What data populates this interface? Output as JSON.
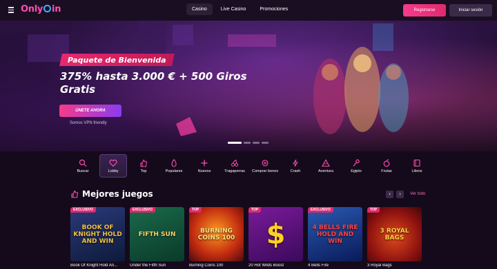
{
  "brand": {
    "logo_left": "Only",
    "logo_right": "in",
    "accent": "#ff4fb0"
  },
  "header": {
    "nav": [
      "Casino",
      "Live Casino",
      "Promociones"
    ],
    "register_label": "Registrarse",
    "login_label": "Iniciar sesión"
  },
  "hero": {
    "tag": "Paquete de Bienvenida",
    "title": "375% hasta 3.000 € + 500 Giros Gratis",
    "cta_label": "ÚNETE AHORA",
    "note": "Somos VPN friendly",
    "slides": 4,
    "active_slide": 1
  },
  "categories": [
    {
      "label": "Buscar",
      "icon": "search-icon"
    },
    {
      "label": "Lobby",
      "icon": "heart-icon"
    },
    {
      "label": "Top",
      "icon": "thumbs-up-icon"
    },
    {
      "label": "Populares",
      "icon": "flame-icon"
    },
    {
      "label": "Nuevos",
      "icon": "plus-icon"
    },
    {
      "label": "Tragaperras",
      "icon": "cherries-icon"
    },
    {
      "label": "Comprar bonos",
      "icon": "bonus-icon"
    },
    {
      "label": "Crash",
      "icon": "lightning-icon"
    },
    {
      "label": "Aventura",
      "icon": "triangle-icon"
    },
    {
      "label": "Egipto",
      "icon": "ankh-icon"
    },
    {
      "label": "Frutas",
      "icon": "fruit-icon"
    },
    {
      "label": "Libros",
      "icon": "book-icon"
    }
  ],
  "section": {
    "title": "Mejores juegos",
    "see_all": "Ver todo",
    "prev": "‹",
    "next": "›"
  },
  "games": [
    {
      "name": "Book Of Knight Hold An...",
      "badge": "EXCLUSIVO",
      "art": "BOOK OF KNIGHT HOLD AND WIN"
    },
    {
      "name": "Under the Fifth Sun",
      "badge": "EXCLUSIVO",
      "art": "FIFTH SUN"
    },
    {
      "name": "Burning Coins 100",
      "badge": "TOP",
      "art": "BURNING COINS 100"
    },
    {
      "name": "20 Hot Wilds Boost",
      "badge": "TOP",
      "art": "$"
    },
    {
      "name": "4 Bells Fire",
      "badge": "EXCLUSIVO",
      "art": "4 BELLS FIRE HOLD AND WIN"
    },
    {
      "name": "3 Royal Bags",
      "badge": "TOP",
      "art": "3 ROYAL BAGS"
    }
  ]
}
